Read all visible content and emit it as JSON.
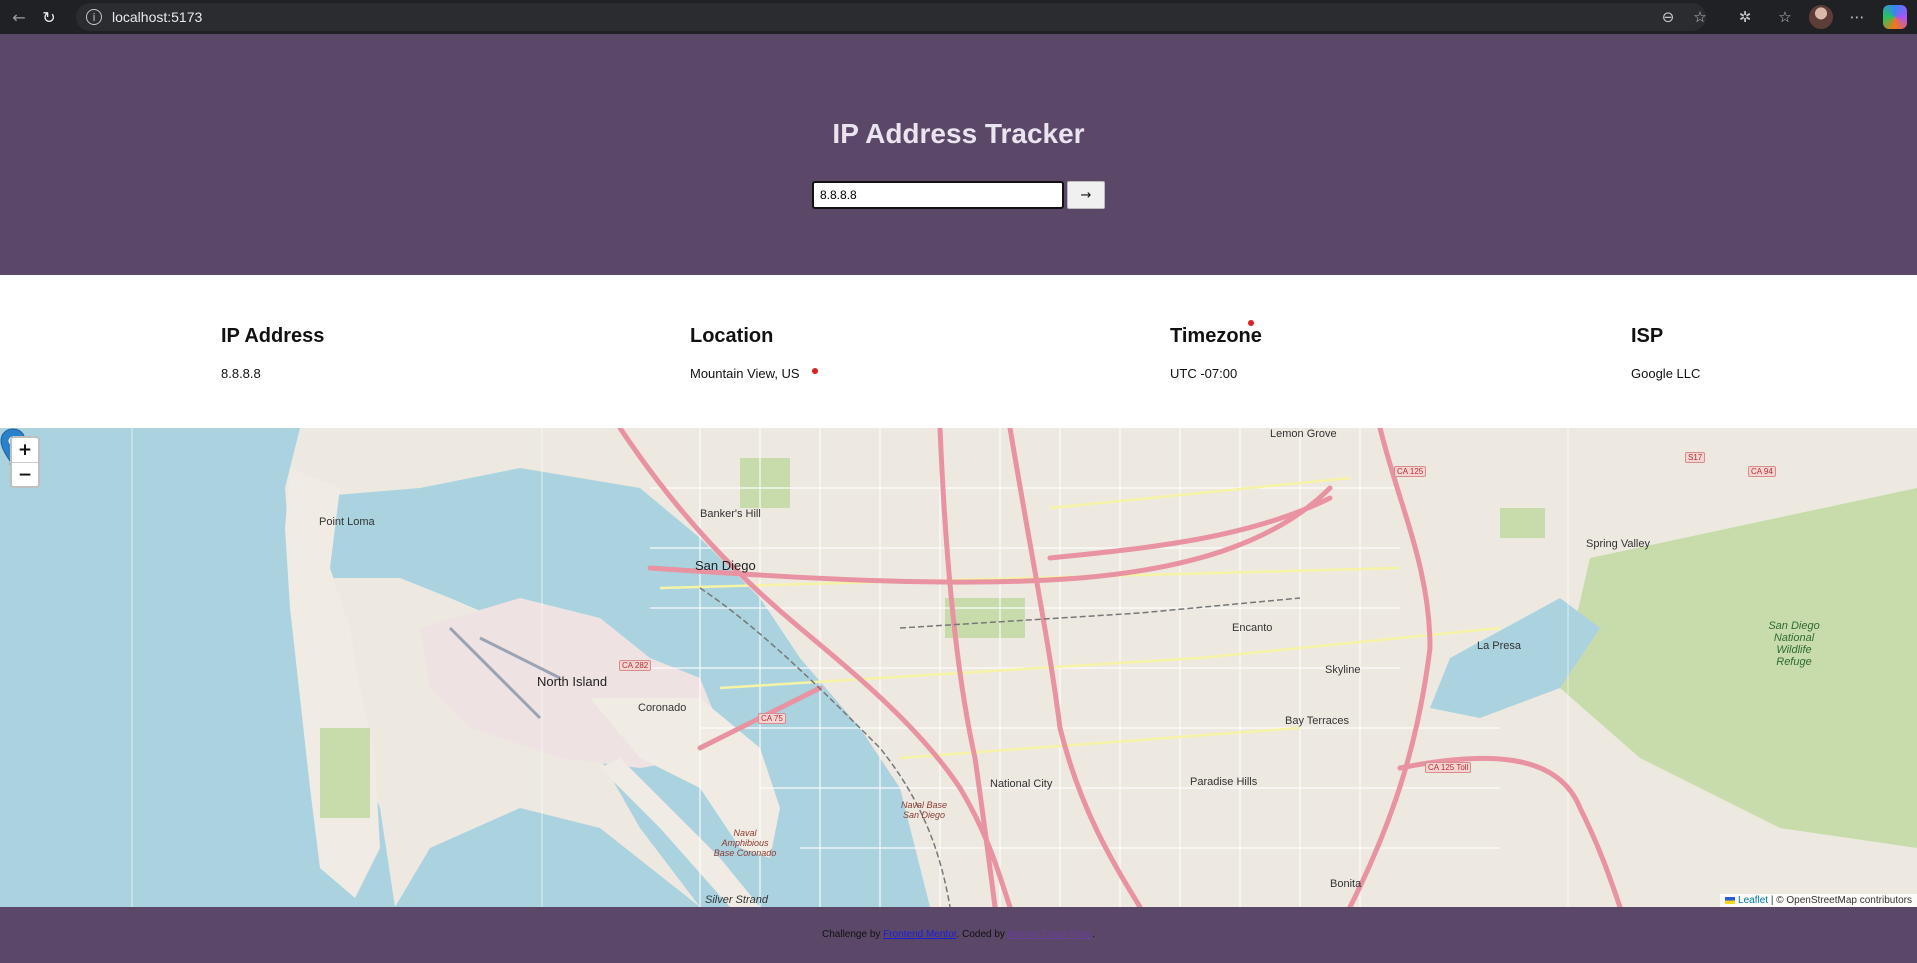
{
  "browser": {
    "url": "localhost:5173",
    "icons": [
      "back-icon",
      "reload-icon",
      "info-icon",
      "zoom-out-icon",
      "star-icon",
      "extensions-icon",
      "favorites-icon",
      "avatar",
      "more-icon",
      "copilot-icon"
    ]
  },
  "header": {
    "title": "IP Address Tracker",
    "search_value": "8.8.8.8",
    "search_button_label": "→"
  },
  "info": {
    "ip": {
      "label": "IP Address",
      "value": "8.8.8.8"
    },
    "location": {
      "label": "Location",
      "value": "Mountain View, US"
    },
    "timezone": {
      "label": "Timezone",
      "value": "UTC -07:00"
    },
    "isp": {
      "label": "ISP",
      "value": "Google LLC"
    }
  },
  "map": {
    "zoom_in": "+",
    "zoom_out": "−",
    "attribution_leaflet": "Leaflet",
    "attribution_rest": "| © OpenStreetMap contributors",
    "labels": {
      "san_diego": "San Diego",
      "north_island": "North Island",
      "coronado": "Coronado",
      "point_loma": "Point Loma",
      "bankers_hill": "Banker's Hill",
      "national_city": "National City",
      "paradise_hills": "Paradise Hills",
      "bay_terraces": "Bay Terraces",
      "skyline": "Skyline",
      "encanto": "Encanto",
      "la_presa": "La Presa",
      "spring_valley": "Spring Valley",
      "lemon_grove": "Lemon Grove",
      "bonita": "Bonita",
      "silver_strand": "Silver Strand",
      "naval_base": "Naval Base San Diego",
      "naval_amphibious": "Naval Amphibious Base Coronado",
      "refuge": "San Diego National Wildlife Refuge",
      "ca282": "CA 282",
      "ca75": "CA 75",
      "ca125": "CA 125",
      "ca125toll": "CA 125 Toll",
      "ca94": "CA 94",
      "s17": "S17"
    }
  },
  "footer": {
    "prefix": "Challenge by",
    "fm_link": "Frontend Mentor",
    "middle": ". Coded by",
    "author_link": "Ammar Daud Khan",
    "suffix": "."
  },
  "colors": {
    "header_bg": "#5b4768",
    "water": "#aad3df",
    "park": "#c8dcab",
    "highway": "#e892a2",
    "marker": "#2a81cb"
  }
}
